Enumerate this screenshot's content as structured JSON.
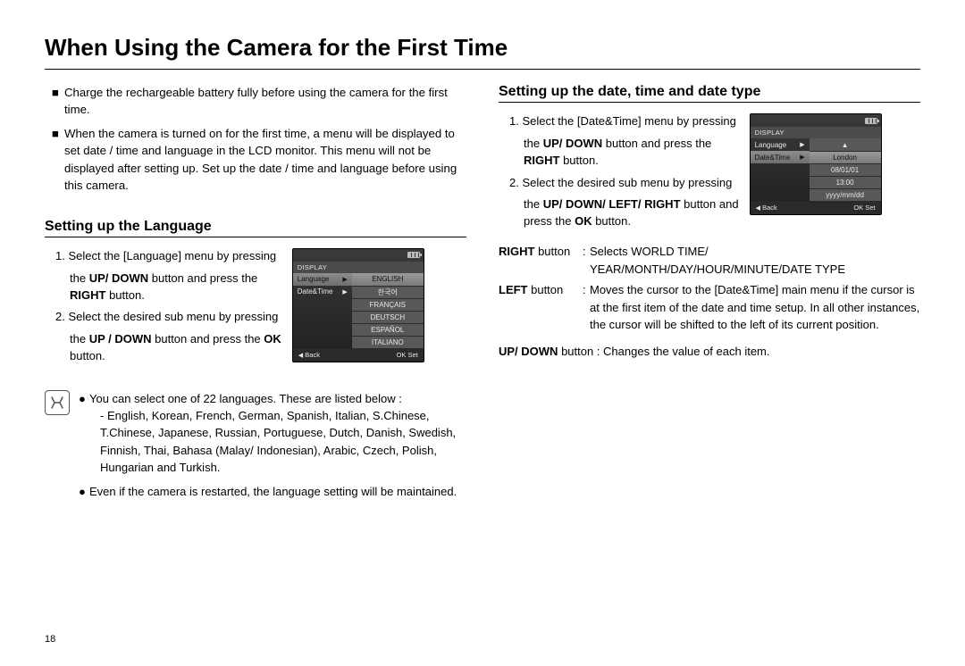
{
  "page_number": "18",
  "title": "When Using the Camera for the First Time",
  "intro": [
    "Charge the rechargeable battery fully before using the camera for the first time.",
    "When the camera is turned on for the first time, a menu will be displayed to set date / time and language in the LCD monitor. This menu will not be displayed after setting up. Set up the date / time and language before using this camera."
  ],
  "left": {
    "heading": "Setting up the Language",
    "steps": {
      "s1a": "1. Select the [Language] menu by pressing",
      "s1b_pre": "the ",
      "s1b_bold": "UP/ DOWN",
      "s1b_mid": " button and press the ",
      "s1c_bold": "RIGHT",
      "s1c_post": " button.",
      "s2a": "2. Select the desired sub menu by pressing",
      "s2b_pre": "the ",
      "s2b_bold": "UP / DOWN",
      "s2b_mid": " button and press the ",
      "s2b_bold2": "OK",
      "s2b_post": " button."
    },
    "lcd": {
      "menu_title": "DISPLAY",
      "items_left": [
        "Language",
        "Date&Time"
      ],
      "selected_left": "Language",
      "options": [
        "ENGLISH",
        "한국어",
        "FRANÇAIS",
        "DEUTSCH",
        "ESPAÑOL",
        "ITALIANO"
      ],
      "selected_option": "ENGLISH",
      "foot_back": "Back",
      "foot_ok": "OK  Set"
    },
    "note": {
      "b1": "You can select one of 22 languages. These are listed below :",
      "b1_detail": "- English, Korean, French, German, Spanish, Italian, S.Chinese, T.Chinese, Japanese, Russian, Portuguese, Dutch, Danish, Swedish, Finnish, Thai, Bahasa (Malay/ Indonesian), Arabic, Czech, Polish, Hungarian and Turkish.",
      "b2": "Even if the camera is restarted, the language setting will be maintained."
    }
  },
  "right": {
    "heading": "Setting up the date, time and date type",
    "steps": {
      "s1a": "1. Select the [Date&Time] menu by pressing",
      "s1b_pre": "the ",
      "s1b_bold": "UP/ DOWN",
      "s1b_mid": " button and press the ",
      "s1c_bold": "RIGHT",
      "s1c_post": " button.",
      "s2a": "2. Select the desired sub menu by pressing",
      "s2b_pre": "the ",
      "s2b_bold": "UP/ DOWN/ LEFT/ RIGHT",
      "s2b_mid": " button and ",
      "s2b_post_pre": "press the ",
      "s2b_bold2": "OK",
      "s2b_post": " button."
    },
    "lcd": {
      "menu_title": "DISPLAY",
      "items_left": [
        "Language",
        "Date&Time"
      ],
      "selected_left": "Date&Time",
      "rows": [
        "London",
        "08/01/01",
        "13:00",
        "yyyy/mm/dd"
      ],
      "selected_row": "London",
      "arrow_row": "▲",
      "foot_back": "Back",
      "foot_ok": "OK  Set"
    },
    "defs": {
      "right_label": "RIGHT",
      "right_suffix": " button",
      "right_text1": "Selects WORLD TIME/",
      "right_text2": "YEAR/MONTH/DAY/HOUR/MINUTE/DATE TYPE",
      "left_label": "LEFT",
      "left_suffix": " button",
      "left_text": "Moves the cursor to the [Date&Time] main menu if the cursor is at the first item of the date and time setup. In all other instances, the cursor will be shifted to the left of its current position.",
      "updown_label": "UP/ DOWN",
      "updown_suffix": " button : ",
      "updown_text": "Changes the value of each item."
    }
  }
}
